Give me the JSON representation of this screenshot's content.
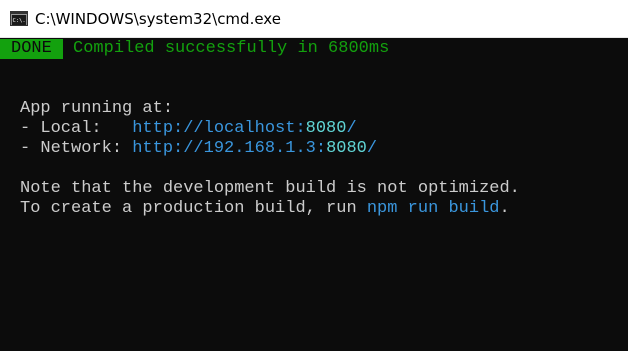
{
  "window": {
    "title": "C:\\WINDOWS\\system32\\cmd.exe",
    "icon": "cmd-icon",
    "icon_text": "C:\\."
  },
  "console": {
    "status_badge": "DONE",
    "status_message": "Compiled successfully in 6800ms",
    "app_running_label": "App running at:",
    "local_label": "- Local:   ",
    "local_url_prefix": "http://localhost:",
    "local_port": "8080",
    "local_url_suffix": "/",
    "network_label": "- Network: ",
    "network_url_prefix": "http://192.168.1.3:",
    "network_port": "8080",
    "network_url_suffix": "/",
    "note_line": "Note that the development build is not optimized.",
    "create_prefix": "To create a production build, run ",
    "create_command": "npm run build",
    "create_suffix": "."
  },
  "colors": {
    "background": "#0c0c0c",
    "text": "#cccccc",
    "green": "#13a10e",
    "cyan": "#3a96dd",
    "port_cyan": "#61d6d6"
  }
}
